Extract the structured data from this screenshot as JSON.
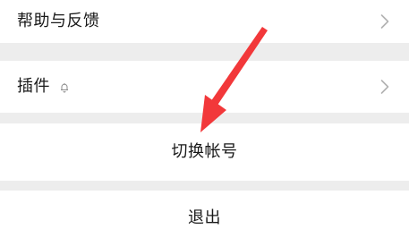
{
  "menu": {
    "help_feedback_label": "帮助与反馈",
    "plugins_label": "插件",
    "switch_account_label": "切换帐号",
    "logout_label": "退出"
  },
  "colors": {
    "background": "#ededed",
    "row": "#ffffff",
    "text": "#191919",
    "chevron": "#b2b2b2",
    "annotation_arrow": "#f2383a"
  },
  "icons": {
    "plugin": "plugin-bell-icon",
    "chevron": "chevron-right-icon",
    "annotation": "red-annotation-arrow"
  }
}
